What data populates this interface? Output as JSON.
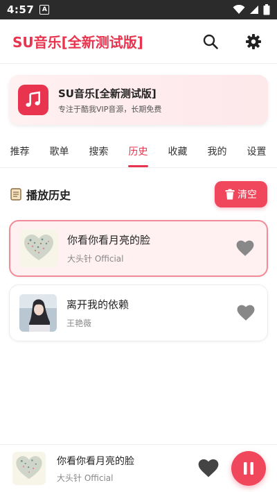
{
  "status_bar": {
    "time": "4:57",
    "notification_letter": "A",
    "icons": [
      "wifi-icon",
      "signal-icon",
      "battery-icon"
    ]
  },
  "app_bar": {
    "title": "SU音乐[全新测试版]",
    "icons": [
      "search-icon",
      "gear-icon"
    ]
  },
  "banner": {
    "title": "SU音乐[全新测试版]",
    "subtitle": "专注于酷我VIP音源，长期免费",
    "icon": "music-note-icon"
  },
  "tabs": [
    {
      "label": "推荐",
      "active": false
    },
    {
      "label": "歌单",
      "active": false
    },
    {
      "label": "搜索",
      "active": false
    },
    {
      "label": "历史",
      "active": true
    },
    {
      "label": "收藏",
      "active": false
    },
    {
      "label": "我的",
      "active": false
    },
    {
      "label": "设置",
      "active": false
    }
  ],
  "history": {
    "section_title": "播放历史",
    "clear_label": "清空",
    "songs": [
      {
        "title": "你看你看月亮的脸",
        "artist": "大头针 Official",
        "active": true
      },
      {
        "title": "离开我的依赖",
        "artist": "王艳薇",
        "active": false
      }
    ]
  },
  "player": {
    "title": "你看你看月亮的脸",
    "artist": "大头针 Official"
  },
  "colors": {
    "accent": "#e8344e",
    "button": "#f0475c",
    "active_card_bg": "#fff0f2",
    "active_card_border": "#f28a98"
  }
}
